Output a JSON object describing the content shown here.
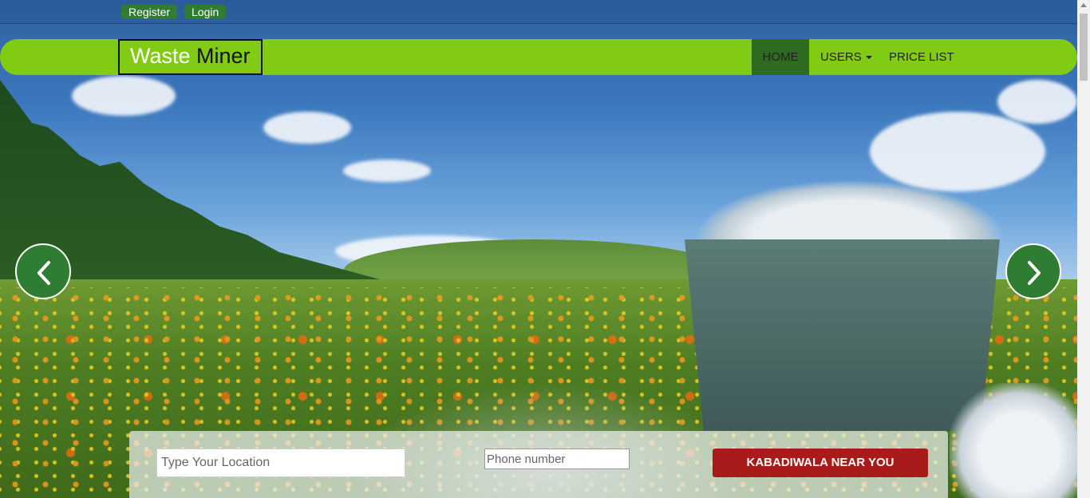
{
  "auth": {
    "register_label": "Register",
    "login_label": "Login"
  },
  "brand": {
    "part1": "Waste",
    "part2": "Miner"
  },
  "nav": {
    "home": "HOME",
    "users": "USERS",
    "price_list": "PRICE LIST",
    "active": "HOME"
  },
  "carousel": {
    "prev_icon": "chevron-left-icon",
    "next_icon": "chevron-right-icon"
  },
  "search": {
    "location_placeholder": "Type Your Location",
    "phone_placeholder": "Phone number",
    "button_label": "KABADIWALA NEAR YOU"
  },
  "colors": {
    "navbar": "#82cb14",
    "accent_green": "#2e7d32",
    "active_nav": "#2e6a1f",
    "button_red": "#a91b1b"
  }
}
